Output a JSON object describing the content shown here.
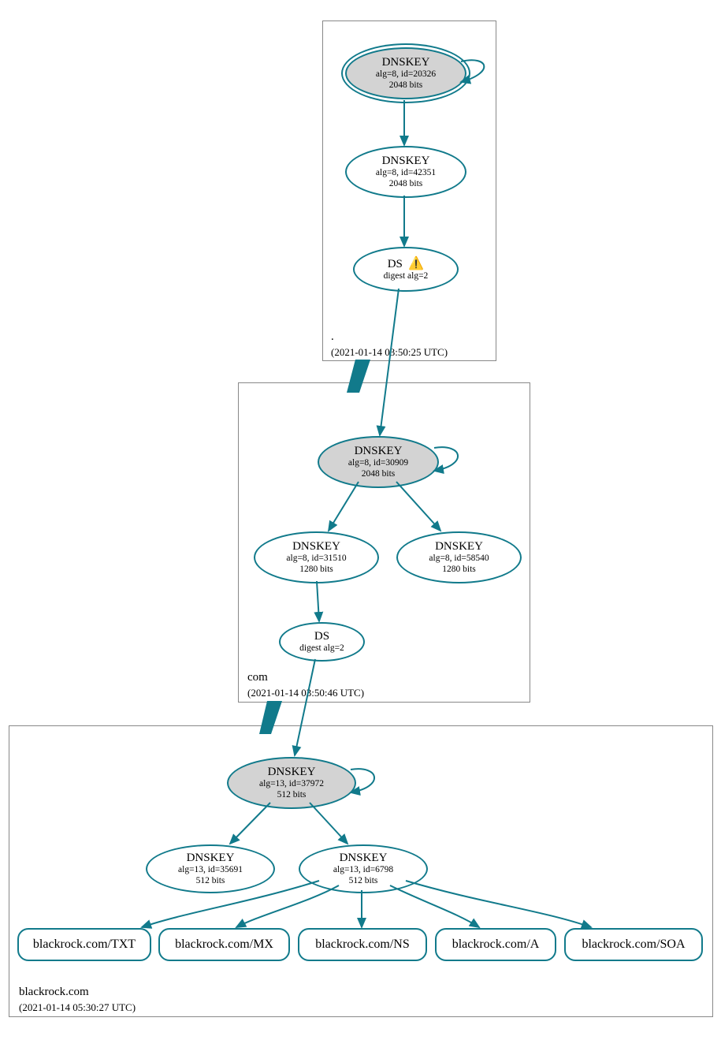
{
  "zone1": {
    "name": ".",
    "timestamp": "(2021-01-14 03:50:25 UTC)",
    "node1": {
      "title": "DNSKEY",
      "line2": "alg=8, id=20326",
      "line3": "2048 bits"
    },
    "node2": {
      "title": "DNSKEY",
      "line2": "alg=8, id=42351",
      "line3": "2048 bits"
    },
    "node3": {
      "title": "DS",
      "line2": "digest alg=2",
      "warn": "⚠️"
    }
  },
  "zone2": {
    "name": "com",
    "timestamp": "(2021-01-14 03:50:46 UTC)",
    "node1": {
      "title": "DNSKEY",
      "line2": "alg=8, id=30909",
      "line3": "2048 bits"
    },
    "node2": {
      "title": "DNSKEY",
      "line2": "alg=8, id=31510",
      "line3": "1280 bits"
    },
    "node3": {
      "title": "DNSKEY",
      "line2": "alg=8, id=58540",
      "line3": "1280 bits"
    },
    "node4": {
      "title": "DS",
      "line2": "digest alg=2"
    }
  },
  "zone3": {
    "name": "blackrock.com",
    "timestamp": "(2021-01-14 05:30:27 UTC)",
    "node1": {
      "title": "DNSKEY",
      "line2": "alg=13, id=37972",
      "line3": "512 bits"
    },
    "node2": {
      "title": "DNSKEY",
      "line2": "alg=13, id=35691",
      "line3": "512 bits"
    },
    "node3": {
      "title": "DNSKEY",
      "line2": "alg=13, id=6798",
      "line3": "512 bits"
    },
    "rr1": "blackrock.com/TXT",
    "rr2": "blackrock.com/MX",
    "rr3": "blackrock.com/NS",
    "rr4": "blackrock.com/A",
    "rr5": "blackrock.com/SOA"
  }
}
